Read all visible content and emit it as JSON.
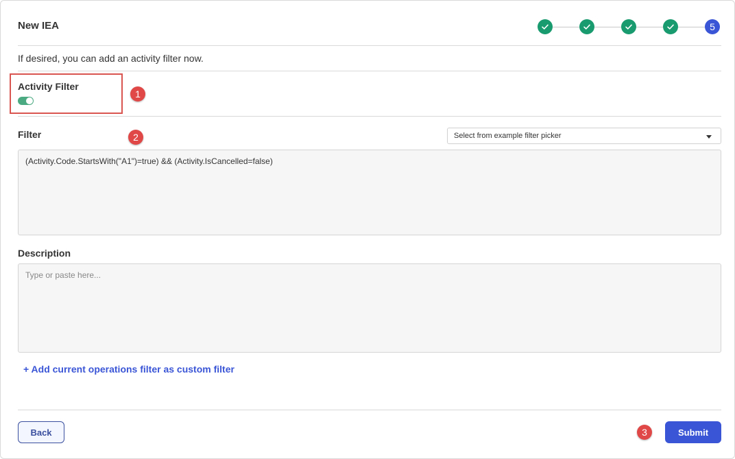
{
  "header": {
    "title": "New IEA",
    "steps": [
      {
        "state": "done",
        "icon": "check-icon"
      },
      {
        "state": "done",
        "icon": "check-icon"
      },
      {
        "state": "done",
        "icon": "check-icon"
      },
      {
        "state": "done",
        "icon": "check-icon"
      },
      {
        "state": "current",
        "label": "5"
      }
    ]
  },
  "intro_text": "If desired, you can add an activity filter now.",
  "activity_filter": {
    "label": "Activity Filter",
    "enabled": true
  },
  "filter": {
    "label": "Filter",
    "picker_value": "Select from example filter picker",
    "value": "(Activity.Code.StartsWith(\"A1\")=true) && (Activity.IsCancelled=false)"
  },
  "description": {
    "label": "Description",
    "placeholder": "Type or paste here..."
  },
  "add_custom_filter_label": "+ Add current operations filter as custom filter",
  "footer": {
    "back_label": "Back",
    "submit_label": "Submit"
  },
  "annotations": {
    "badge_1": "1",
    "badge_2": "2",
    "badge_3": "3"
  },
  "colors": {
    "step_done": "#1a9b6f",
    "step_current": "#3a55d6",
    "toggle_on": "#4caa82",
    "primary": "#3a55d6",
    "annotation": "#e04848"
  }
}
